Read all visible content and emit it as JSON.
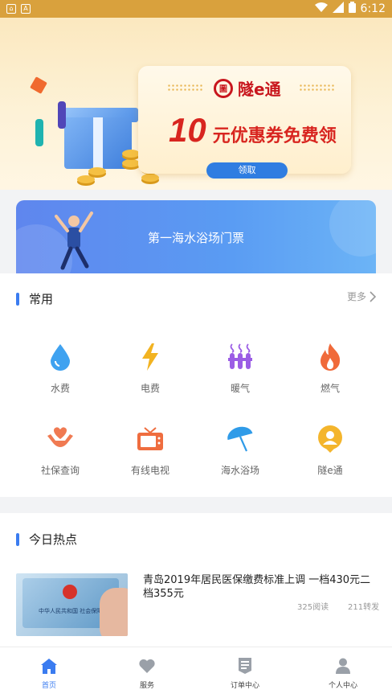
{
  "status_bar": {
    "time": "6:12"
  },
  "banner": {
    "brand_logo_char": "圖",
    "brand_name": "隧e通",
    "promo_amount": "10",
    "promo_text": "元优惠券免费领",
    "claim_label": "领取"
  },
  "ticket_card": {
    "title": "第一海水浴场门票"
  },
  "common_section": {
    "title": "常用",
    "more_label": "更多",
    "items": [
      {
        "label": "水费",
        "icon": "water-drop-icon",
        "color": "#3fa2f0"
      },
      {
        "label": "电费",
        "icon": "lightning-icon",
        "color": "#f2b321"
      },
      {
        "label": "暖气",
        "icon": "radiator-icon",
        "color": "#9b5de5"
      },
      {
        "label": "燃气",
        "icon": "flame-icon",
        "color": "#f06a3a"
      },
      {
        "label": "社保查询",
        "icon": "hands-heart-icon",
        "color": "#f07a52"
      },
      {
        "label": "有线电视",
        "icon": "tv-icon",
        "color": "#ef6d3f"
      },
      {
        "label": "海水浴场",
        "icon": "umbrella-icon",
        "color": "#2f9be8"
      },
      {
        "label": "隧e通",
        "icon": "avatar-badge-icon",
        "color": "#f4b52c"
      }
    ]
  },
  "hot_section": {
    "title": "今日热点",
    "news": [
      {
        "title": "青岛2019年居民医保缴费标准上调 一档430元二档355元",
        "reads": "325阅读",
        "shares": "211转发",
        "image_caption": "中华人民共和国 社会保障卡"
      }
    ]
  },
  "tab_bar": {
    "tabs": [
      {
        "label": "首页",
        "icon": "home-icon",
        "active": true
      },
      {
        "label": "服务",
        "icon": "heart-icon",
        "active": false
      },
      {
        "label": "订单中心",
        "icon": "document-icon",
        "active": false
      },
      {
        "label": "个人中心",
        "icon": "person-icon",
        "active": false
      }
    ]
  },
  "colors": {
    "accent": "#3b7cf0",
    "promo_red": "#d8251f",
    "status_bar": "#d9a13d"
  }
}
